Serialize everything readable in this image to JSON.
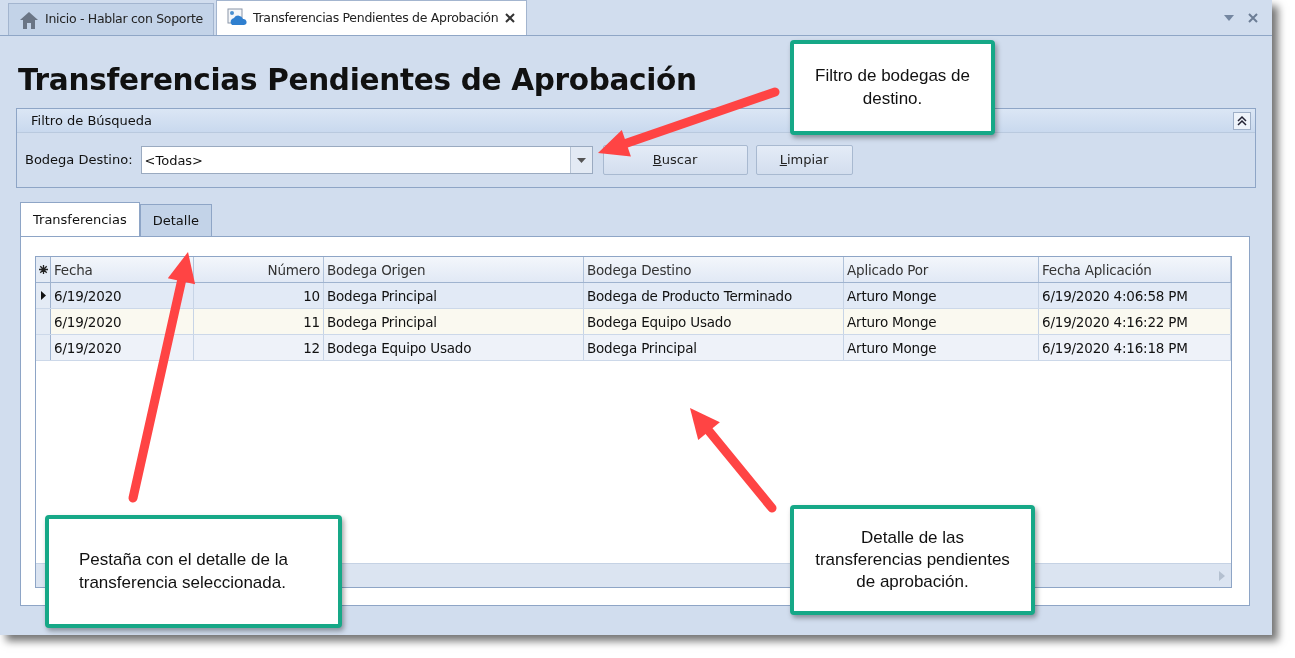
{
  "window": {
    "tabs": [
      {
        "label": "Inicio - Hablar con Soporte",
        "kind": "home",
        "selected": false,
        "closable": false
      },
      {
        "label": "Transferencias Pendientes de Aprobación",
        "kind": "form",
        "selected": true,
        "closable": true
      }
    ]
  },
  "title": "Transferencias Pendientes de Aprobación",
  "filter": {
    "title": "Filtro de Búsqueda",
    "label": "Bodega Destino:",
    "value": "<Todas>",
    "buttons": [
      "Buscar",
      "Limpiar"
    ]
  },
  "tabs": [
    {
      "label": "Transferencias",
      "selected": true
    },
    {
      "label": "Detalle",
      "selected": false
    }
  ],
  "table": {
    "columns": [
      {
        "label": "Fecha",
        "numeric": false
      },
      {
        "label": "Número",
        "numeric": true
      },
      {
        "label": "Bodega Origen",
        "numeric": false
      },
      {
        "label": "Bodega Destino",
        "numeric": false
      },
      {
        "label": "Aplicado Por",
        "numeric": false
      },
      {
        "label": "Fecha Aplicación",
        "numeric": false
      }
    ],
    "rows": [
      {
        "selected": true,
        "cells": [
          "6/19/2020",
          "10",
          "Bodega Principal",
          "Bodega de Producto Terminado",
          "Arturo Monge",
          "6/19/2020 4:06:58 PM"
        ]
      },
      {
        "selected": false,
        "cells": [
          "6/19/2020",
          "11",
          "Bodega Principal",
          "Bodega Equipo Usado",
          "Arturo Monge",
          "6/19/2020 4:16:22 PM"
        ]
      },
      {
        "selected": false,
        "cells": [
          "6/19/2020",
          "12",
          "Bodega Equipo Usado",
          "Bodega Principal",
          "Arturo Monge",
          "6/19/2020 4:16:18 PM"
        ]
      }
    ]
  },
  "callouts": [
    {
      "text": "Filtro de bodegas de destino."
    },
    {
      "text": "Pestaña con el detalle de la transferencia seleccionada."
    },
    {
      "text": "Detalle de las transferencias pendientes de aprobación."
    }
  ]
}
